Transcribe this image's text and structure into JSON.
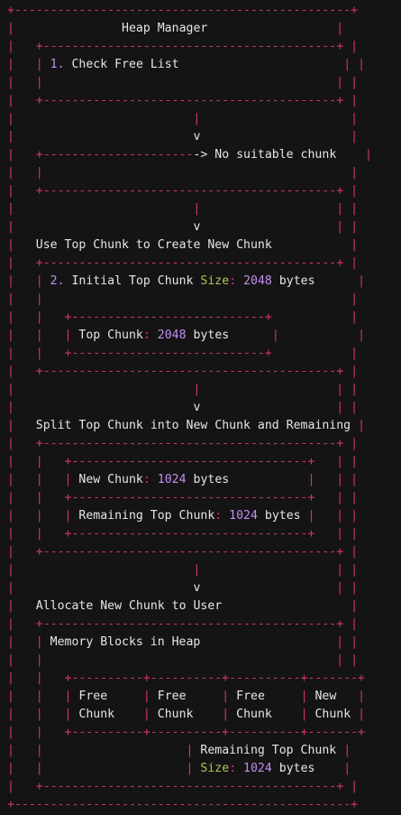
{
  "title": "Heap Manager",
  "sections": {
    "check_free_list": {
      "index": "1.",
      "label": "Check Free List",
      "branch_label": "No suitable chunk"
    },
    "use_top_chunk": {
      "label": "Use Top Chunk to Create New Chunk",
      "index": "2.",
      "initial_text": "Initial Top Chunk",
      "size_label": "Size",
      "size_value": "2048",
      "unit": "bytes",
      "top_chunk_label": "Top Chunk",
      "top_chunk_value": "2048",
      "top_chunk_unit": "bytes"
    },
    "split": {
      "label": "Split Top Chunk into New Chunk and Remaining",
      "new_chunk_label": "New Chunk",
      "new_chunk_value": "1024",
      "new_chunk_unit": "bytes",
      "remaining_label": "Remaining Top Chunk",
      "remaining_value": "1024",
      "remaining_unit": "bytes"
    },
    "allocate": {
      "label": "Allocate New Chunk to User",
      "memory_title": "Memory Blocks in Heap",
      "blocks": [
        {
          "line1": "Free",
          "line2": "Chunk"
        },
        {
          "line1": "Free",
          "line2": "Chunk"
        },
        {
          "line1": "Free",
          "line2": "Chunk"
        },
        {
          "line1": "New",
          "line2": "Chunk"
        }
      ],
      "remaining_label": "Remaining Top Chunk",
      "remaining_size_label": "Size",
      "remaining_size_value": "1024",
      "remaining_size_unit": "bytes"
    }
  },
  "colors": {
    "background": "#141414",
    "border": "#d6336c",
    "text": "#e6e6e6",
    "keyword": "#a6c75a",
    "number": "#c28ef0"
  }
}
